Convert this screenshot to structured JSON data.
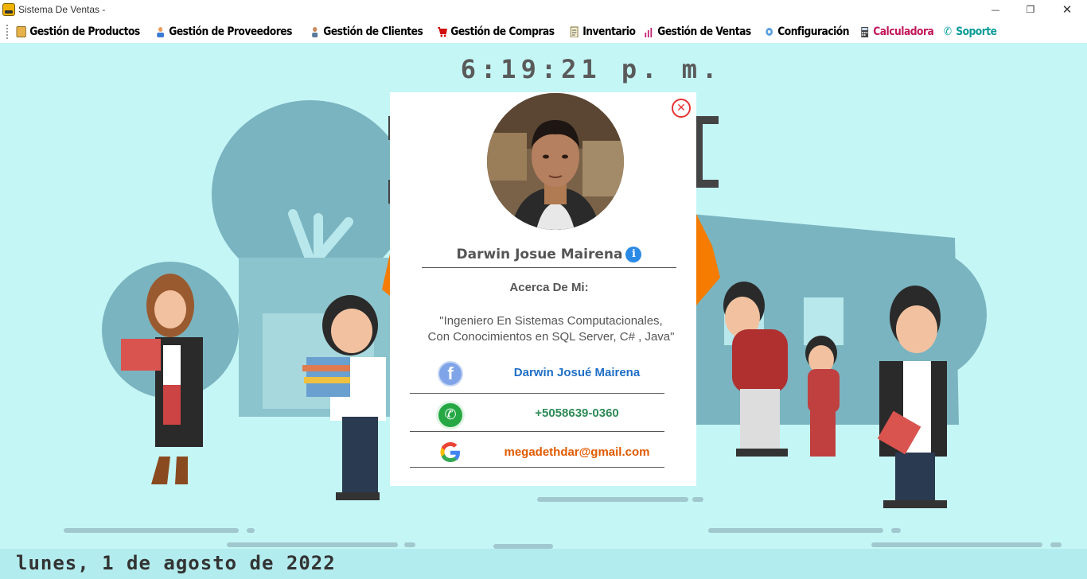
{
  "window": {
    "title": "Sistema De Ventas -",
    "minimize_glyph": "—",
    "restore_glyph": "❐",
    "close_glyph": "✕"
  },
  "menu": {
    "items": [
      {
        "label": "Gestión de Productos",
        "icon": "box-icon",
        "color": "#000000"
      },
      {
        "label": "Gestión de Proveedores",
        "icon": "supplier-icon",
        "color": "#000000"
      },
      {
        "label": "Gestión de Clientes",
        "icon": "client-icon",
        "color": "#000000"
      },
      {
        "label": "Gestión de Compras",
        "icon": "cart-icon",
        "color": "#000000"
      },
      {
        "label": "Inventario",
        "icon": "clipboard-icon",
        "color": "#000000"
      },
      {
        "label": "Gestión de Ventas",
        "icon": "sales-chart-icon",
        "color": "#000000"
      },
      {
        "label": "Configuración",
        "icon": "gear-icon",
        "color": "#000000"
      },
      {
        "label": "Calculadora",
        "icon": "calculator-icon",
        "color": "#c2185b"
      },
      {
        "label": "Soporte",
        "icon": "phone-icon",
        "color": "#0a9a9a"
      }
    ]
  },
  "clock": {
    "time": "6:19:21 p. m."
  },
  "status": {
    "date": "lunes, 1 de agosto de 2022"
  },
  "profile": {
    "name": "Darwin Josue Mairena",
    "close_glyph": "✕",
    "info_glyph": "i",
    "about_title": "Acerca De Mi:",
    "about_line1": "\"Ingeniero En Sistemas Computacionales,",
    "about_line2": "Con Conocimientos en SQL Server, C# , Java\"",
    "contacts": [
      {
        "icon": "facebook-icon",
        "glyph": "f",
        "text": "Darwin Josué Mairena",
        "color": "#1f6fc5"
      },
      {
        "icon": "whatsapp-icon",
        "glyph": "✆",
        "text": "+5058639-0360",
        "color": "#2e8b57"
      },
      {
        "icon": "google-icon",
        "glyph": "G",
        "text": "megadethdar@gmail.com",
        "color": "#e05a00"
      }
    ]
  },
  "colors": {
    "background": "#c5f6f6",
    "statusbar": "#b3ecee",
    "accent_blue": "#2b8ae6",
    "close_red": "#e63232"
  }
}
